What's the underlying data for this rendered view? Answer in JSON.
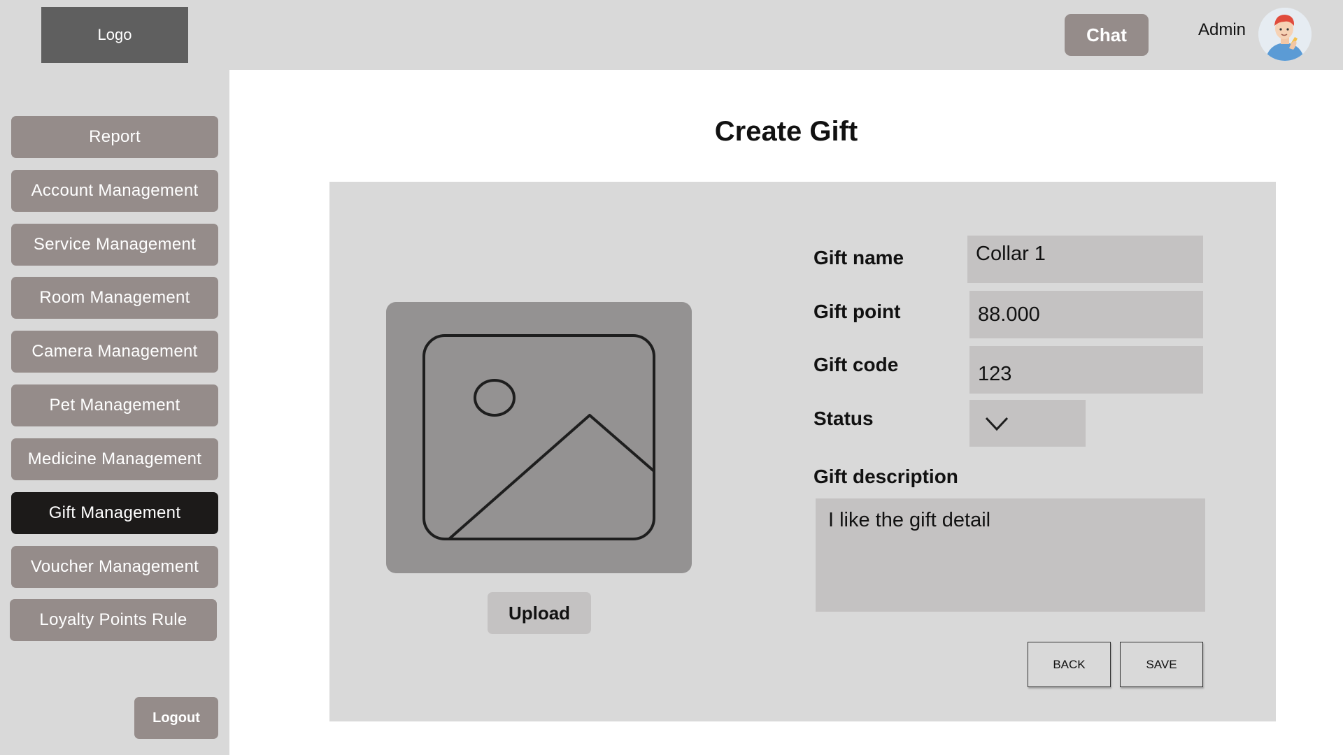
{
  "header": {
    "logo_text": "Logo",
    "chat_label": "Chat",
    "user_label": "Admin"
  },
  "sidebar": {
    "items": [
      {
        "label": "Report",
        "active": false
      },
      {
        "label": "Account Management",
        "active": false
      },
      {
        "label": "Service Management",
        "active": false
      },
      {
        "label": "Room Management",
        "active": false
      },
      {
        "label": "Camera Management",
        "active": false
      },
      {
        "label": "Pet Management",
        "active": false
      },
      {
        "label": "Medicine Management",
        "active": false
      },
      {
        "label": "Gift Management",
        "active": true
      },
      {
        "label": "Voucher Management",
        "active": false
      },
      {
        "label": "Loyalty Points Rule",
        "active": false
      }
    ],
    "logout_label": "Logout"
  },
  "main": {
    "title": "Create Gift",
    "upload_label": "Upload",
    "form": {
      "gift_name_label": "Gift name",
      "gift_name_value": "Collar 1",
      "gift_point_label": "Gift point",
      "gift_point_value": "88.000",
      "gift_code_label": "Gift code",
      "gift_code_value": "123",
      "status_label": "Status",
      "status_value": "",
      "description_label": "Gift description",
      "description_value": "I like the gift detail"
    },
    "back_label": "BACK",
    "save_label": "SAVE"
  },
  "colors": {
    "nav_button": "#958c8a",
    "nav_active": "#1c1a19",
    "panel_bg": "#d9d9d9",
    "input_bg": "#c4c2c2"
  },
  "icons": {
    "image_placeholder": "image-placeholder-icon",
    "status_dropdown": "chevron-down-icon",
    "avatar": "avatar"
  }
}
